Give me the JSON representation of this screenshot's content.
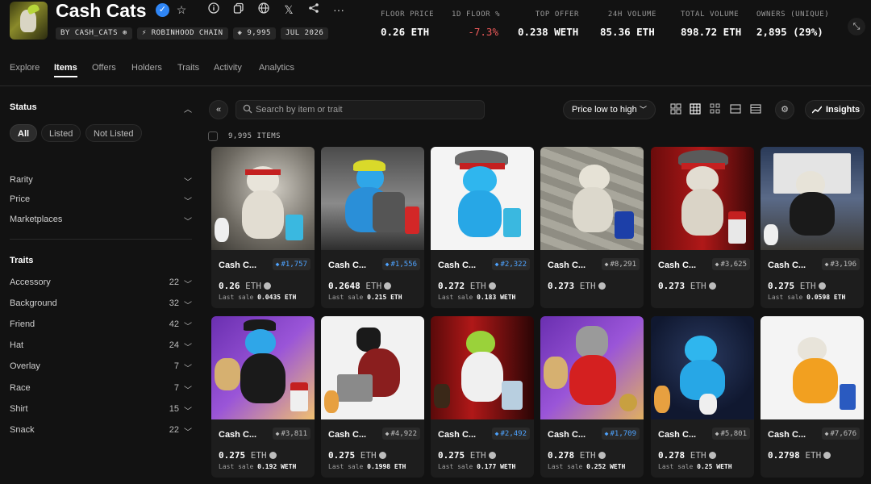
{
  "collection": {
    "title": "Cash Cats",
    "chips": [
      "BY CASH_CATS",
      "ROBINHOOD CHAIN",
      "9,995",
      "JUL 2026"
    ]
  },
  "stats": [
    {
      "label": "FLOOR PRICE",
      "value": "0.26 ETH"
    },
    {
      "label": "1D FLOOR %",
      "value": "-7.3%"
    },
    {
      "label": "TOP OFFER",
      "value": "0.238 WETH"
    },
    {
      "label": "24H VOLUME",
      "value": "85.36 ETH"
    },
    {
      "label": "TOTAL VOLUME",
      "value": "898.72 ETH"
    },
    {
      "label": "OWNERS (UNIQUE)",
      "value": "2,895 (29%)"
    }
  ],
  "tabs": [
    "Explore",
    "Items",
    "Offers",
    "Holders",
    "Traits",
    "Activity",
    "Analytics"
  ],
  "sidebar": {
    "status_heading": "Status",
    "status_pills": [
      "All",
      "Listed",
      "Not Listed"
    ],
    "filters": [
      "Rarity",
      "Price",
      "Marketplaces"
    ],
    "traits_heading": "Traits",
    "traits": [
      {
        "name": "Accessory",
        "count": "22"
      },
      {
        "name": "Background",
        "count": "32"
      },
      {
        "name": "Friend",
        "count": "42"
      },
      {
        "name": "Hat",
        "count": "24"
      },
      {
        "name": "Overlay",
        "count": "7"
      },
      {
        "name": "Race",
        "count": "7"
      },
      {
        "name": "Shirt",
        "count": "15"
      },
      {
        "name": "Snack",
        "count": "22"
      }
    ]
  },
  "toolbar": {
    "search_placeholder": "Search by item or trait",
    "sort_label": "Price low to high",
    "insights_label": "Insights",
    "items_count": "9,995 ITEMS"
  },
  "cards": [
    {
      "name": "Cash C...",
      "num": "#1,757",
      "rare": true,
      "price": "0.26",
      "unit": "ETH",
      "last_sale": "0.0435 ETH"
    },
    {
      "name": "Cash C...",
      "num": "#1,556",
      "rare": true,
      "price": "0.2648",
      "unit": "ETH",
      "last_sale": "0.215 ETH"
    },
    {
      "name": "Cash C...",
      "num": "#2,322",
      "rare": true,
      "price": "0.272",
      "unit": "ETH",
      "last_sale": "0.183 WETH"
    },
    {
      "name": "Cash C...",
      "num": "#8,291",
      "rare": false,
      "price": "0.273",
      "unit": "ETH",
      "last_sale": ""
    },
    {
      "name": "Cash C...",
      "num": "#3,625",
      "rare": false,
      "price": "0.273",
      "unit": "ETH",
      "last_sale": ""
    },
    {
      "name": "Cash C...",
      "num": "#3,196",
      "rare": false,
      "price": "0.275",
      "unit": "ETH",
      "last_sale": "0.0598 ETH"
    },
    {
      "name": "Cash C...",
      "num": "#3,811",
      "rare": false,
      "price": "0.275",
      "unit": "ETH",
      "last_sale": "0.192 WETH"
    },
    {
      "name": "Cash C...",
      "num": "#4,922",
      "rare": false,
      "price": "0.275",
      "unit": "ETH",
      "last_sale": "0.1998 ETH"
    },
    {
      "name": "Cash C...",
      "num": "#2,492",
      "rare": true,
      "price": "0.275",
      "unit": "ETH",
      "last_sale": "0.177 WETH"
    },
    {
      "name": "Cash C...",
      "num": "#1,709",
      "rare": true,
      "price": "0.278",
      "unit": "ETH",
      "last_sale": "0.252 WETH"
    },
    {
      "name": "Cash C...",
      "num": "#5,801",
      "rare": false,
      "price": "0.278",
      "unit": "ETH",
      "last_sale": "0.25 WETH"
    },
    {
      "name": "Cash C...",
      "num": "#7,676",
      "rare": false,
      "price": "0.2798",
      "unit": "ETH",
      "last_sale": ""
    }
  ],
  "colors": {
    "accent_blue": "#2f86f6",
    "negative": "#ef5a5a",
    "rare_badge": "#4ea3ff",
    "background": "#121212"
  }
}
